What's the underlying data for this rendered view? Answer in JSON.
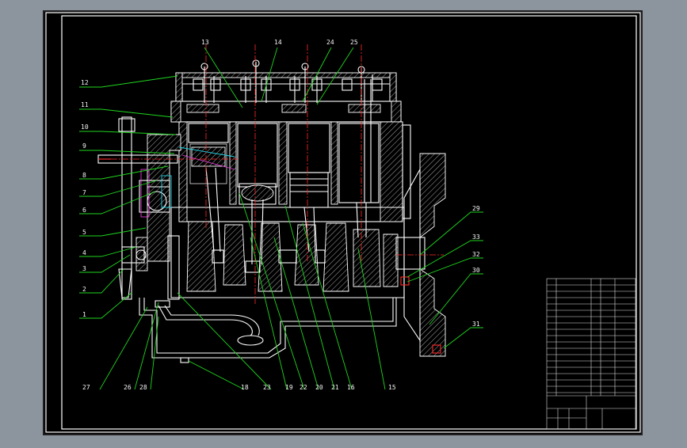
{
  "labels_left": [
    "12",
    "11",
    "10",
    "9",
    "8",
    "7",
    "6",
    "5",
    "4",
    "3",
    "2",
    "1"
  ],
  "labels_top": [
    "13",
    "14",
    "24",
    "25"
  ],
  "labels_right": [
    "29",
    "33",
    "32",
    "30",
    "31"
  ],
  "labels_bottom": [
    "27",
    "26",
    "28",
    "18",
    "23",
    "19",
    "22",
    "20",
    "21",
    "16",
    "15"
  ],
  "title_block": {
    "designation": "",
    "note": ""
  },
  "colors": {
    "sheet": "#000000",
    "window": "#8c949e",
    "leader": "#1fd51f",
    "centerline": "#ff2a2a",
    "outline": "#ffffff"
  }
}
